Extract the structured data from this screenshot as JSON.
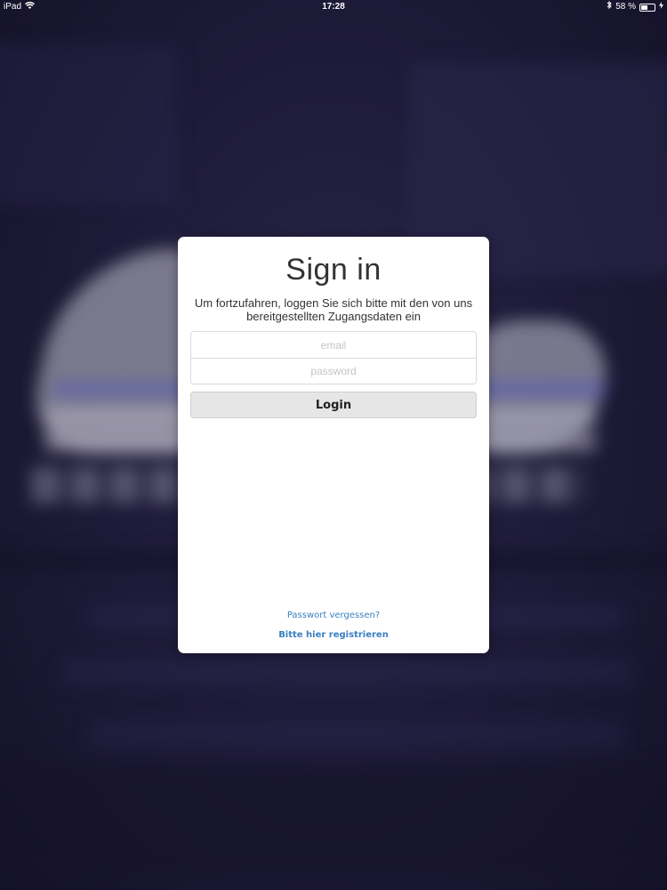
{
  "status_bar": {
    "device": "iPad",
    "wifi_icon": "wifi-icon",
    "time": "17:28",
    "bluetooth_icon": "bluetooth-icon",
    "battery_text": "58 %",
    "battery_level": 0.58,
    "charging_icon": "charging-bolt-icon"
  },
  "signin": {
    "title": "Sign in",
    "subtitle": "Um fortzufahren, loggen Sie sich bitte mit den von uns bereitgestellten Zugangsdaten ein",
    "email_placeholder": "email",
    "password_placeholder": "password",
    "login_label": "Login",
    "forgot_password": "Passwort vergessen?",
    "register": "Bitte hier registrieren"
  },
  "colors": {
    "link": "#3a7fc1",
    "background": "#1c1933",
    "button_bg": "#e6e6e6"
  }
}
